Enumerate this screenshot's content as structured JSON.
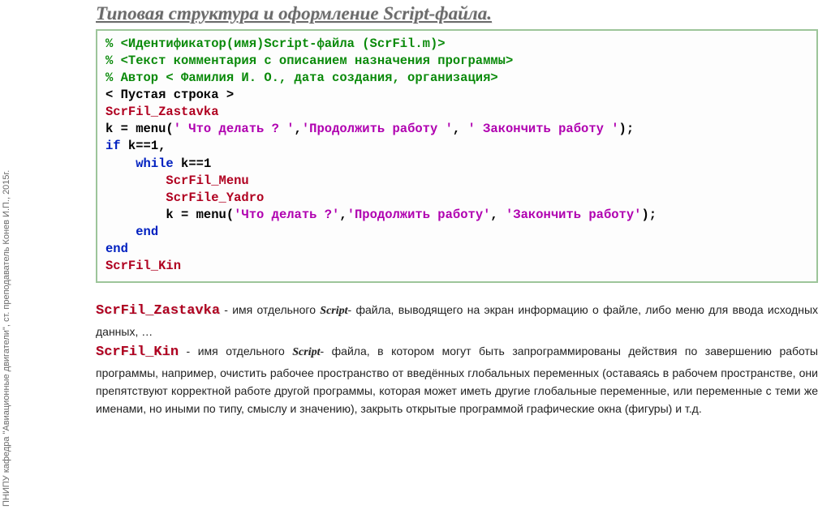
{
  "sidebar_text": "ПНИПУ кафедра \"Авиационные двигатели\", ст. преподаватель Конев И.П., 2015г.",
  "title": "Типовая структура и оформление Script-файла.",
  "code": {
    "c1": "% <Идентификатор(имя)Script-файла (ScrFil.m)>",
    "c2": "% <Текст комментария с описанием назначения программы>",
    "c3": "% Автор < Фамилия И. О., дата создания, организация>",
    "c4": "< Пустая строка >",
    "c5": "ScrFil_Zastavka",
    "c6a": "k = menu(",
    "c6s1": "' Что делать ? '",
    "c6s2": "'Продолжить работу '",
    "c6s3": "' Закончить работу '",
    "c6z": ");",
    "c7a": "if",
    "c7b": " k==1,",
    "c8a": "while",
    "c8b": " k==1",
    "c9": "ScrFil_Menu",
    "c10": "ScrFile_Yadro",
    "c11a": "k = menu(",
    "c11s1": "'Что делать ?'",
    "c11s2": "'Продолжить работу'",
    "c11s3": "'Закончить работу'",
    "c11z": ");",
    "c12": "end",
    "c13": "end",
    "c14": "ScrFil_Kin",
    "comma": ",",
    "comma_sp": ", "
  },
  "desc": {
    "t1": "ScrFil_Zastavka",
    "p1a": " - имя отдельного ",
    "scriptword": "Script",
    "p1b": "- файла, выводящего на экран информацию о файле, либо меню для ввода исходных данных, …",
    "t2": "ScrFil_Kin",
    "p2a": " - имя отдельного ",
    "p2b": "- файла, в котором могут быть запрограммированы действия по завершению работы программы, например, очистить рабочее пространство от введённых глобальных переменных (оставаясь в рабочем пространстве, они препятствуют корректной работе другой программы, которая может иметь другие глобальные переменные, или переменные с теми же именами, но иными по типу, смыслу и значению), закрыть открытые программой графические окна (фигуры) и т.д."
  }
}
